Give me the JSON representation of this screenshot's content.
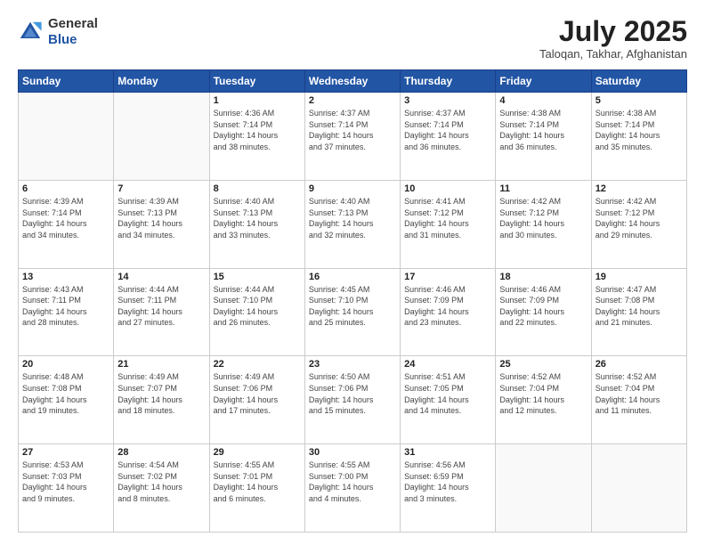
{
  "header": {
    "logo_line1": "General",
    "logo_line2": "Blue",
    "month_title": "July 2025",
    "location": "Taloqan, Takhar, Afghanistan"
  },
  "weekdays": [
    "Sunday",
    "Monday",
    "Tuesday",
    "Wednesday",
    "Thursday",
    "Friday",
    "Saturday"
  ],
  "weeks": [
    [
      {
        "day": "",
        "info": ""
      },
      {
        "day": "",
        "info": ""
      },
      {
        "day": "1",
        "info": "Sunrise: 4:36 AM\nSunset: 7:14 PM\nDaylight: 14 hours\nand 38 minutes."
      },
      {
        "day": "2",
        "info": "Sunrise: 4:37 AM\nSunset: 7:14 PM\nDaylight: 14 hours\nand 37 minutes."
      },
      {
        "day": "3",
        "info": "Sunrise: 4:37 AM\nSunset: 7:14 PM\nDaylight: 14 hours\nand 36 minutes."
      },
      {
        "day": "4",
        "info": "Sunrise: 4:38 AM\nSunset: 7:14 PM\nDaylight: 14 hours\nand 36 minutes."
      },
      {
        "day": "5",
        "info": "Sunrise: 4:38 AM\nSunset: 7:14 PM\nDaylight: 14 hours\nand 35 minutes."
      }
    ],
    [
      {
        "day": "6",
        "info": "Sunrise: 4:39 AM\nSunset: 7:14 PM\nDaylight: 14 hours\nand 34 minutes."
      },
      {
        "day": "7",
        "info": "Sunrise: 4:39 AM\nSunset: 7:13 PM\nDaylight: 14 hours\nand 34 minutes."
      },
      {
        "day": "8",
        "info": "Sunrise: 4:40 AM\nSunset: 7:13 PM\nDaylight: 14 hours\nand 33 minutes."
      },
      {
        "day": "9",
        "info": "Sunrise: 4:40 AM\nSunset: 7:13 PM\nDaylight: 14 hours\nand 32 minutes."
      },
      {
        "day": "10",
        "info": "Sunrise: 4:41 AM\nSunset: 7:12 PM\nDaylight: 14 hours\nand 31 minutes."
      },
      {
        "day": "11",
        "info": "Sunrise: 4:42 AM\nSunset: 7:12 PM\nDaylight: 14 hours\nand 30 minutes."
      },
      {
        "day": "12",
        "info": "Sunrise: 4:42 AM\nSunset: 7:12 PM\nDaylight: 14 hours\nand 29 minutes."
      }
    ],
    [
      {
        "day": "13",
        "info": "Sunrise: 4:43 AM\nSunset: 7:11 PM\nDaylight: 14 hours\nand 28 minutes."
      },
      {
        "day": "14",
        "info": "Sunrise: 4:44 AM\nSunset: 7:11 PM\nDaylight: 14 hours\nand 27 minutes."
      },
      {
        "day": "15",
        "info": "Sunrise: 4:44 AM\nSunset: 7:10 PM\nDaylight: 14 hours\nand 26 minutes."
      },
      {
        "day": "16",
        "info": "Sunrise: 4:45 AM\nSunset: 7:10 PM\nDaylight: 14 hours\nand 25 minutes."
      },
      {
        "day": "17",
        "info": "Sunrise: 4:46 AM\nSunset: 7:09 PM\nDaylight: 14 hours\nand 23 minutes."
      },
      {
        "day": "18",
        "info": "Sunrise: 4:46 AM\nSunset: 7:09 PM\nDaylight: 14 hours\nand 22 minutes."
      },
      {
        "day": "19",
        "info": "Sunrise: 4:47 AM\nSunset: 7:08 PM\nDaylight: 14 hours\nand 21 minutes."
      }
    ],
    [
      {
        "day": "20",
        "info": "Sunrise: 4:48 AM\nSunset: 7:08 PM\nDaylight: 14 hours\nand 19 minutes."
      },
      {
        "day": "21",
        "info": "Sunrise: 4:49 AM\nSunset: 7:07 PM\nDaylight: 14 hours\nand 18 minutes."
      },
      {
        "day": "22",
        "info": "Sunrise: 4:49 AM\nSunset: 7:06 PM\nDaylight: 14 hours\nand 17 minutes."
      },
      {
        "day": "23",
        "info": "Sunrise: 4:50 AM\nSunset: 7:06 PM\nDaylight: 14 hours\nand 15 minutes."
      },
      {
        "day": "24",
        "info": "Sunrise: 4:51 AM\nSunset: 7:05 PM\nDaylight: 14 hours\nand 14 minutes."
      },
      {
        "day": "25",
        "info": "Sunrise: 4:52 AM\nSunset: 7:04 PM\nDaylight: 14 hours\nand 12 minutes."
      },
      {
        "day": "26",
        "info": "Sunrise: 4:52 AM\nSunset: 7:04 PM\nDaylight: 14 hours\nand 11 minutes."
      }
    ],
    [
      {
        "day": "27",
        "info": "Sunrise: 4:53 AM\nSunset: 7:03 PM\nDaylight: 14 hours\nand 9 minutes."
      },
      {
        "day": "28",
        "info": "Sunrise: 4:54 AM\nSunset: 7:02 PM\nDaylight: 14 hours\nand 8 minutes."
      },
      {
        "day": "29",
        "info": "Sunrise: 4:55 AM\nSunset: 7:01 PM\nDaylight: 14 hours\nand 6 minutes."
      },
      {
        "day": "30",
        "info": "Sunrise: 4:55 AM\nSunset: 7:00 PM\nDaylight: 14 hours\nand 4 minutes."
      },
      {
        "day": "31",
        "info": "Sunrise: 4:56 AM\nSunset: 6:59 PM\nDaylight: 14 hours\nand 3 minutes."
      },
      {
        "day": "",
        "info": ""
      },
      {
        "day": "",
        "info": ""
      }
    ]
  ]
}
